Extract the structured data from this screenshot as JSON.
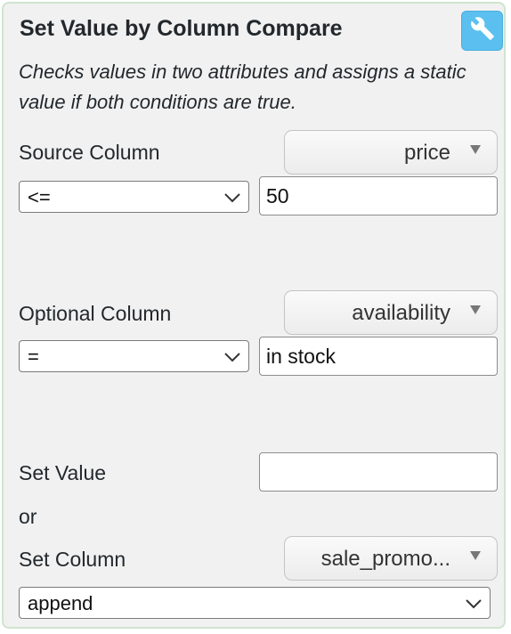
{
  "panel": {
    "title": "Set Value by Column Compare",
    "description": "Checks values in two attributes and assigns a static value if both conditions are true.",
    "settings_icon": "wrench-icon",
    "accent_color": "#5bc0f0"
  },
  "source": {
    "label": "Source Column",
    "column_value": "price",
    "operator_value": "<=",
    "compare_value": "50"
  },
  "optional": {
    "label": "Optional Column",
    "column_value": "availability",
    "operator_value": "=",
    "compare_value": "in stock"
  },
  "set_value": {
    "label": "Set Value",
    "value": ""
  },
  "or_label": "or",
  "set_column": {
    "label": "Set Column",
    "column_value": "sale_promo...",
    "mode_value": "append"
  }
}
